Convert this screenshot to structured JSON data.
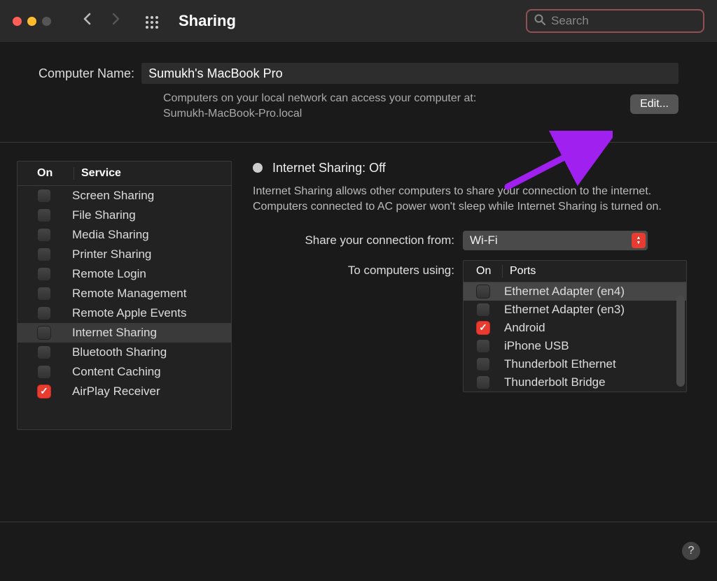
{
  "titleBar": {
    "title": "Sharing",
    "searchPlaceholder": "Search"
  },
  "topSection": {
    "computerNameLabel": "Computer Name:",
    "computerNameValue": "Sumukh's MacBook Pro",
    "descLine1": "Computers on your local network can access your computer at:",
    "descLine2": "Sumukh-MacBook-Pro.local",
    "editButton": "Edit..."
  },
  "servicesPanel": {
    "onHeader": "On",
    "serviceHeader": "Service",
    "items": [
      {
        "label": "Screen Sharing",
        "checked": false,
        "selected": false
      },
      {
        "label": "File Sharing",
        "checked": false,
        "selected": false
      },
      {
        "label": "Media Sharing",
        "checked": false,
        "selected": false
      },
      {
        "label": "Printer Sharing",
        "checked": false,
        "selected": false
      },
      {
        "label": "Remote Login",
        "checked": false,
        "selected": false
      },
      {
        "label": "Remote Management",
        "checked": false,
        "selected": false
      },
      {
        "label": "Remote Apple Events",
        "checked": false,
        "selected": false
      },
      {
        "label": "Internet Sharing",
        "checked": false,
        "selected": true
      },
      {
        "label": "Bluetooth Sharing",
        "checked": false,
        "selected": false
      },
      {
        "label": "Content Caching",
        "checked": false,
        "selected": false
      },
      {
        "label": "AirPlay Receiver",
        "checked": true,
        "selected": false
      }
    ]
  },
  "detailPanel": {
    "statusTitle": "Internet Sharing: Off",
    "statusDesc": "Internet Sharing allows other computers to share your connection to the internet. Computers connected to AC power won't sleep while Internet Sharing is turned on.",
    "shareFromLabel": "Share your connection from:",
    "shareFromValue": "Wi-Fi",
    "toComputersLabel": "To computers using:",
    "portsOnHeader": "On",
    "portsHeader": "Ports",
    "ports": [
      {
        "label": "Ethernet Adapter (en4)",
        "checked": false,
        "selected": true
      },
      {
        "label": "Ethernet Adapter (en3)",
        "checked": false,
        "selected": false
      },
      {
        "label": "Android",
        "checked": true,
        "selected": false
      },
      {
        "label": "iPhone USB",
        "checked": false,
        "selected": false
      },
      {
        "label": "Thunderbolt Ethernet",
        "checked": false,
        "selected": false
      },
      {
        "label": "Thunderbolt Bridge",
        "checked": false,
        "selected": false
      }
    ]
  },
  "annotation": {
    "arrowColor": "#a020f0"
  }
}
